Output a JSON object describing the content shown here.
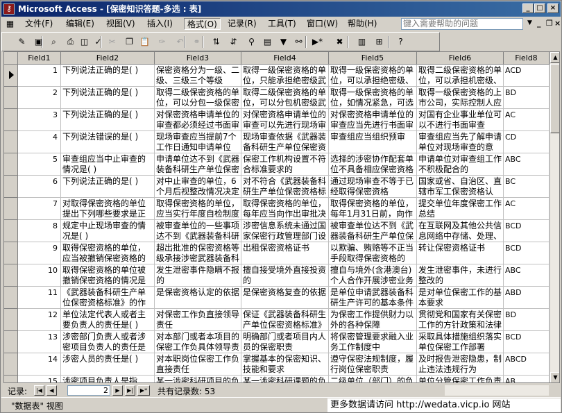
{
  "window": {
    "title": "Microsoft Access - [保密知识答题-多选 : 表]",
    "app_icon": "access-key-icon",
    "buttons": {
      "minimize": "_",
      "maximize": "□",
      "close": "×"
    }
  },
  "menu": {
    "items": [
      "文件(F)",
      "编辑(E)",
      "视图(V)",
      "插入(I)",
      "格式(O)",
      "记录(R)",
      "工具(T)",
      "窗口(W)",
      "帮助(H)"
    ],
    "active_index": 4,
    "help_placeholder": "键入需要帮助的问题",
    "mdi": {
      "minimize": "_",
      "restore": "❐",
      "close": "×"
    }
  },
  "toolbar": {
    "icons": [
      {
        "name": "view-icon",
        "glyph": "✎",
        "dim": false
      },
      {
        "name": "save-icon",
        "glyph": "▣",
        "dim": false
      },
      {
        "name": "search-file-icon",
        "glyph": "⌕",
        "dim": false
      },
      {
        "name": "print-icon",
        "glyph": "⎙",
        "dim": false
      },
      {
        "name": "print-preview-icon",
        "glyph": "◫",
        "dim": false
      },
      {
        "name": "spelling-icon",
        "glyph": "✓",
        "dim": false
      },
      {
        "name": "cut-icon",
        "glyph": "✂",
        "dim": true
      },
      {
        "name": "copy-icon",
        "glyph": "❐",
        "dim": false
      },
      {
        "name": "paste-icon",
        "glyph": "📋",
        "dim": false
      },
      {
        "name": "format-painter-icon",
        "glyph": "✑",
        "dim": true
      },
      {
        "name": "undo-icon",
        "glyph": "↶",
        "dim": true
      },
      {
        "name": "hyperlink-icon",
        "glyph": "⚭",
        "dim": true
      },
      {
        "name": "sort-ascending-icon",
        "glyph": "⇅",
        "dim": false
      },
      {
        "name": "sort-descending-icon",
        "glyph": "⇵",
        "dim": false
      },
      {
        "name": "filter-by-selection-icon",
        "glyph": "⚲",
        "dim": false
      },
      {
        "name": "filter-by-form-icon",
        "glyph": "▤",
        "dim": false
      },
      {
        "name": "apply-filter-icon",
        "glyph": "▼",
        "dim": false
      },
      {
        "name": "find-icon",
        "glyph": "⚯",
        "dim": false
      },
      {
        "name": "new-record-icon",
        "glyph": "▶*",
        "dim": false
      },
      {
        "name": "delete-record-icon",
        "glyph": "✖",
        "dim": false
      },
      {
        "name": "database-window-icon",
        "glyph": "▥",
        "dim": false
      },
      {
        "name": "new-object-icon",
        "glyph": "⊞",
        "dim": false
      },
      {
        "name": "help-icon",
        "glyph": "?",
        "dim": false
      }
    ]
  },
  "table": {
    "headers": [
      "Field1",
      "Field2",
      "Field3",
      "Field4",
      "Field5",
      "Field6",
      "Field8"
    ],
    "current_row": 1,
    "rows": [
      [
        "1",
        "下列说法正确的是( )",
        "保密资格分为一级、二级、三级三个等级",
        "取得一级保密资格的单位，只能承担绝密级武",
        "取得一级保密资格的单位，可以承担绝密级、",
        "取得二级保密资格的单位，可以承担机密级、",
        "ACD"
      ],
      [
        "2",
        "下列说法正确的是( )",
        "取得二级保密资格的单位，可以分包一级保密",
        "取得二级保密资格的单位，可以分包机密级武",
        "取得一级保密资格的单位，如情况紧急，可选",
        "取得一级保密资格的上市公司，实际控制人应",
        "BD"
      ],
      [
        "3",
        "下列说法正确的是( )",
        "对保密资格申请单位的审查都必须经过书面审",
        "对保密资格申请单位的审查可以先进行现场审",
        "对保密资格申请单位的审查应当先进行书面审",
        "对国有企业事业单位可以不进行书面审查",
        "AC"
      ],
      [
        "4",
        "下列说法错误的是( )",
        "现场审查应当提前7个工作日通知申请单位",
        "现场审查依据《武器装备科研生产单位保密资",
        "审查组应当组织预审",
        "审查组应当先了解申请单位对现场审查的意",
        "CD"
      ],
      [
        "5",
        "审查组应当中止审查的情况是( )",
        "申请单位达不到《武器装备科研生产单位保密",
        "保密工作机构设置不符合标准要求的",
        "选择的涉密协作配套单位不具备相应保密资格",
        "申请单位对审查组工作不积极配合的",
        "ABC"
      ],
      [
        "6",
        "下列说法正确的是( )",
        "对中止审查的单位，6个月后视整改情况决定",
        "对不符合《武器装备科研生产单位保密资格标",
        "通过现场审查不等于已经取得保密资格",
        "国家或省、自治区、直辖市军工保密资格认",
        "BC"
      ],
      [
        "7",
        "对取得保密资格的单位提出下列哪些要求是正",
        "取得保密资格的单位，应当实行年度自检制度",
        "取得保密资格的单位，每年应当向作出审批决",
        "取得保密资格的单位，每年1月31日前，向作",
        "提交单位年度保密工作总结",
        "AC"
      ],
      [
        "8",
        "规定中止现场审查的情况是( )",
        "被审查单位的一些事项达不到《武器装备科研",
        "涉密信息系统未通过国家保密行政管理部门设",
        "被审查单位达不到《武器装备科研生产单位保",
        "在互联网及其他公共信息网络中存储、处理、",
        "BCD"
      ],
      [
        "9",
        "取得保密资格的单位，应当被撤销保密资格的",
        "超出批准的保密资格等级承接涉密武器装备科",
        "出租保密资格证书",
        "以欺骗、贿赂等不正当手段取得保密资格的",
        "转让保密资格证书",
        "BCD"
      ],
      [
        "10",
        "取得保密资格的单位被撤销保密资格的情况是",
        "发生泄密事件隐瞒不报的",
        "擅自接受境外直接投资的",
        "擅自与境外(含港澳台)个人合作开展涉密业务",
        "发生泄密事件，未进行整改的",
        "ABC"
      ],
      [
        "11",
        "《武器装备科研生产单位保密资格标准》的作",
        "是保密资格认定的依据",
        "是保密资格复查的依据",
        "是单位申请武器装备科研生产许可的基本条件",
        "是对单位保密工作的基本要求",
        "ABD"
      ],
      [
        "12",
        "单位法定代表人或者主要负责人的责任是( )",
        "对保密工作负直接领导责任",
        "保证《武器装备科研生产单位保密资格标准》",
        "为保密工作提供财力以外的各种保障",
        "贯彻党和国家有关保密工作的方针政策和法律",
        "BD"
      ],
      [
        "13",
        "涉密部门负责人或者涉密项目负责人的责任是",
        "对本部门或者本项目的保密工作负具体领导责",
        "明确部门或者项目内人员的保密职责",
        "将保密管理要求融入业务工作制度中",
        "采取具体措施组织落实单位保密工作部署",
        "BCD"
      ],
      [
        "14",
        "涉密人员的责任是( )",
        "对本职岗位保密工作负直接责任",
        "掌握基本的保密知识、技能和要求",
        "遵守保密法规制度，履行岗位保密职责",
        "及时报告泄密隐患，制止违法违规行为",
        "ABCD"
      ],
      [
        "15",
        "涉密项目负责人是指",
        "某一涉密科研项目的负",
        "某一涉密科研课题的负",
        "二级单位（部门）的负",
        "单位分管保密工作负责",
        "AB"
      ]
    ]
  },
  "navigation": {
    "label": "记录:",
    "current": "2",
    "count_text": "共有记录数: 53",
    "first": "|◀",
    "prev": "◀",
    "next": "▶",
    "last": "▶|",
    "new": "▶*"
  },
  "status": {
    "text": "\"数据表\" 视图",
    "watermark": "更多数据请访问 http://wedata.vicp.io 网站"
  }
}
